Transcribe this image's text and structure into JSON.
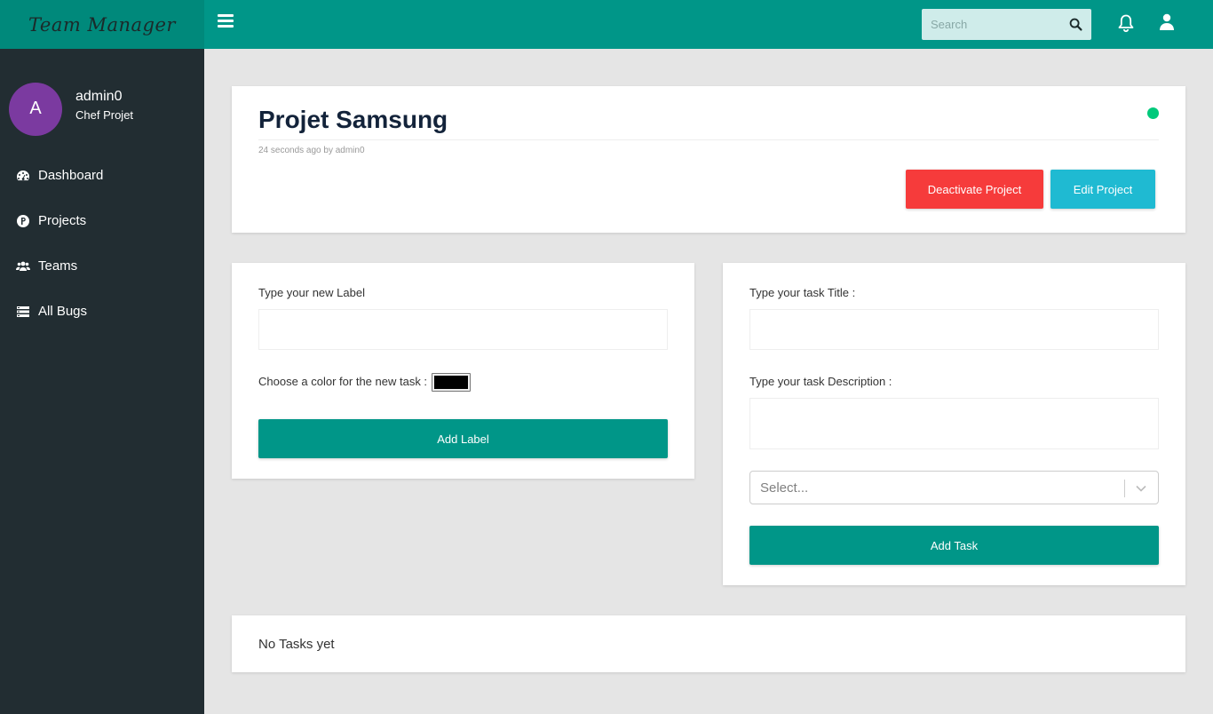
{
  "app": {
    "brand": "Team Manager"
  },
  "user": {
    "initial": "A",
    "name": "admin0",
    "role": "Chef Projet"
  },
  "sidebar": {
    "items": [
      {
        "label": "Dashboard",
        "icon": "dashboard-icon"
      },
      {
        "label": "Projects",
        "icon": "project-p-icon"
      },
      {
        "label": "Teams",
        "icon": "users-icon"
      },
      {
        "label": "All Bugs",
        "icon": "list-icon"
      }
    ]
  },
  "topbar": {
    "search_placeholder": "Search"
  },
  "project": {
    "title": "Projet Samsung",
    "meta": "24 seconds ago by  admin0",
    "status_color": "#00c97b",
    "deactivate_label": "Deactivate Project",
    "edit_label": "Edit Project"
  },
  "label_form": {
    "label_prompt": "Type your new Label",
    "label_value": "",
    "color_prompt": "Choose a color for the new task :",
    "color_value": "#000000",
    "submit_label": "Add Label"
  },
  "task_form": {
    "title_prompt": "Type your task Title :",
    "title_value": "",
    "description_prompt": "Type your task Description :",
    "description_value": "",
    "select_placeholder": "Select...",
    "submit_label": "Add Task"
  },
  "tasks": {
    "empty_text": "No Tasks yet"
  },
  "colors": {
    "primary": "#009688",
    "danger": "#f63b3b",
    "info": "#1fbad2",
    "sidebar": "#222d32"
  }
}
